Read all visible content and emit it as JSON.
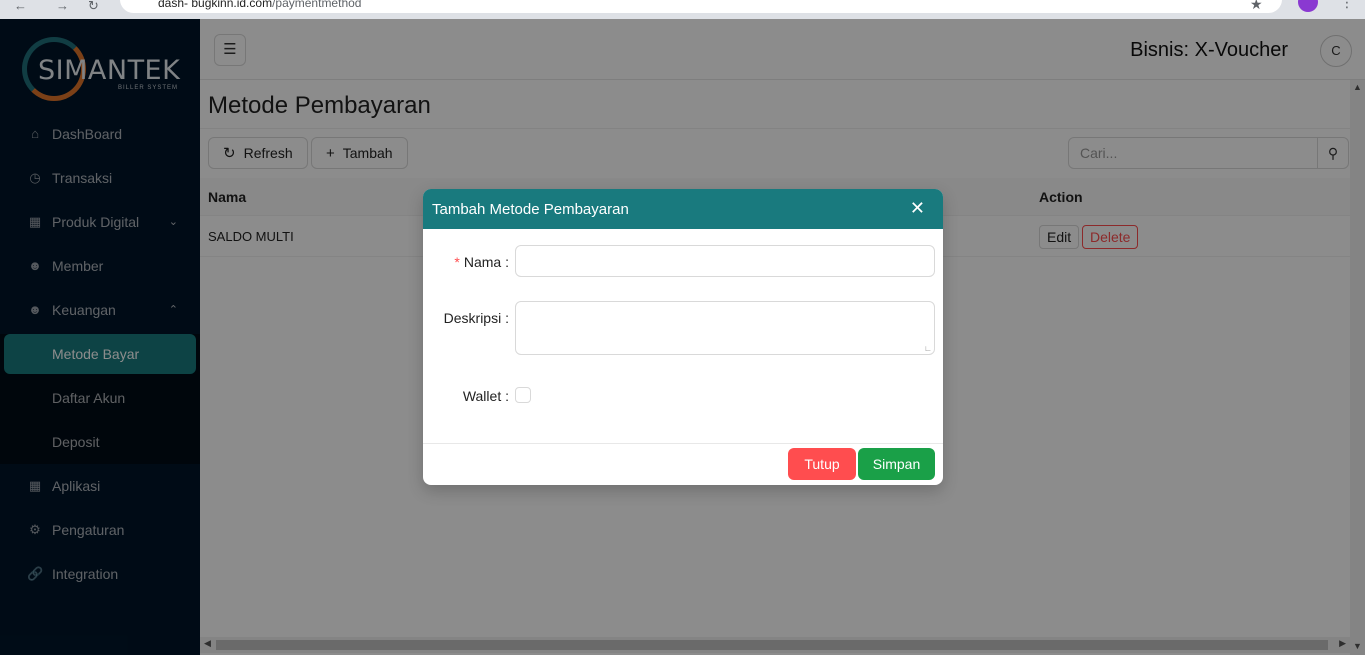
{
  "browser": {
    "url_host": "dash- bugkinn.id.com",
    "url_path": "/paymentmethod"
  },
  "sidebar": {
    "logo_text": "SIMANTEK",
    "logo_subtext": "BILLER SYSTEM",
    "items": [
      {
        "label": "DashBoard",
        "icon": "home-icon"
      },
      {
        "label": "Transaksi",
        "icon": "clock-icon"
      },
      {
        "label": "Produk Digital",
        "icon": "grid-icon"
      },
      {
        "label": "Member",
        "icon": "users-icon"
      },
      {
        "label": "Keuangan",
        "icon": "users-icon"
      },
      {
        "label": "Aplikasi",
        "icon": "grid-icon"
      },
      {
        "label": "Pengaturan",
        "icon": "gear-icon"
      },
      {
        "label": "Integration",
        "icon": "link-icon"
      }
    ],
    "submenu": [
      {
        "label": "Metode Bayar",
        "active": true
      },
      {
        "label": "Daftar Akun",
        "active": false
      },
      {
        "label": "Deposit",
        "active": false
      }
    ]
  },
  "header": {
    "business": "Bisnis: X-Voucher",
    "avatar_initial": "C"
  },
  "page": {
    "title": "Metode Pembayaran",
    "refresh_label": "Refresh",
    "add_label": "Tambah",
    "search_placeholder": "Cari..."
  },
  "table": {
    "columns": [
      "Nama",
      "Action"
    ],
    "rows": [
      {
        "nama": "SALDO MULTI",
        "edit_label": "Edit",
        "delete_label": "Delete"
      }
    ]
  },
  "modal": {
    "title": "Tambah Metode Pembayaran",
    "fields": {
      "nama_label": "Nama",
      "deskripsi_label": "Deskripsi",
      "wallet_label": "Wallet"
    },
    "close_label": "Tutup",
    "save_label": "Simpan"
  },
  "colors": {
    "sidebar_bg": "#001529",
    "accent": "#197a7e",
    "danger": "#ff4d4f",
    "success": "#1aa048"
  }
}
